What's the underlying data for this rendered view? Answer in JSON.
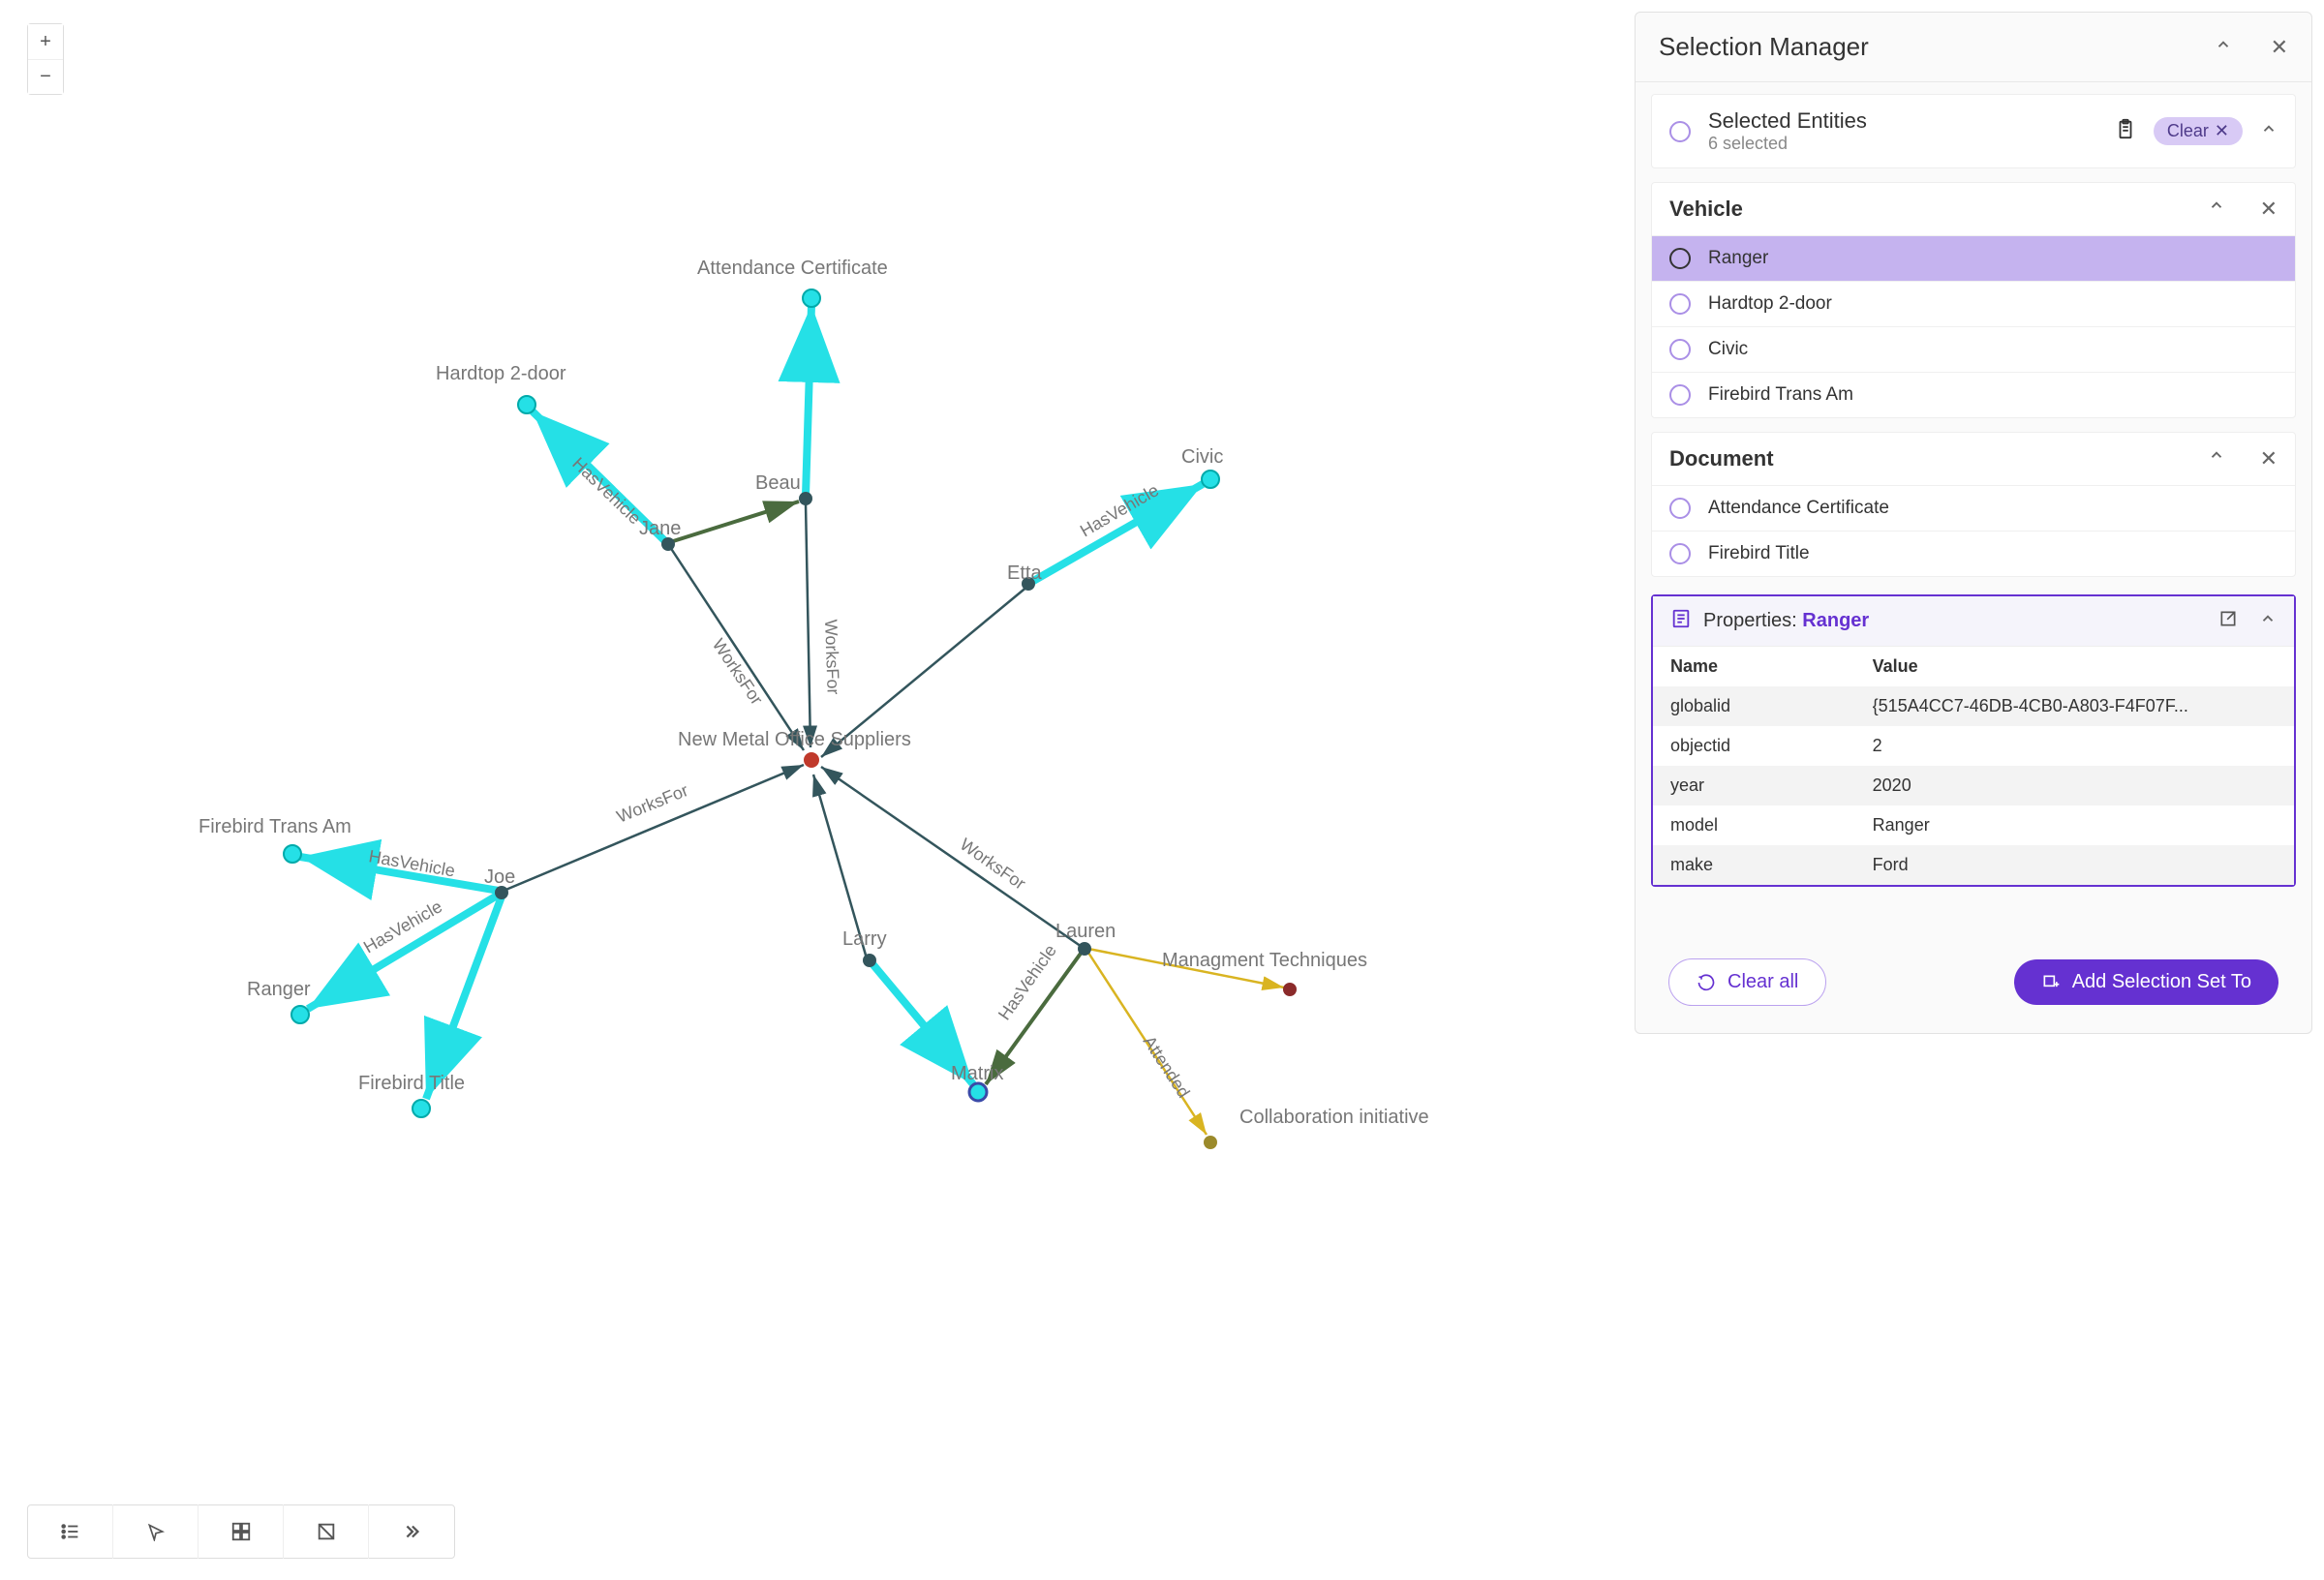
{
  "zoom": {
    "in": "+",
    "out": "−"
  },
  "toolbar": {
    "tool1": "list-icon",
    "tool2": "cursor-icon",
    "tool3": "select-group-icon",
    "tool4": "geometry-icon",
    "tool5": "more-icon"
  },
  "graph": {
    "nodes": {
      "attendance_cert": "Attendance Certificate",
      "hardtop": "Hardtop 2-door",
      "beau": "Beau",
      "jane": "Jane",
      "civic": "Civic",
      "etta": "Etta",
      "new_metal": "New Metal Office Suppliers",
      "firebird_trans_am": "Firebird Trans Am",
      "joe": "Joe",
      "ranger": "Ranger",
      "firebird_title": "Firebird Title",
      "larry": "Larry",
      "lauren": "Lauren",
      "matrix": "Matrix",
      "mgmt_tech": "Managment Techniques",
      "collab": "Collaboration initiative"
    },
    "edges": {
      "has_vehicle": "HasVehicle",
      "works_for": "WorksFor",
      "attended": "Attended"
    }
  },
  "panel": {
    "title": "Selection Manager",
    "selected_entities_label": "Selected Entities",
    "selected_count": "6 selected",
    "clear_label": "Clear",
    "sections": {
      "vehicle": {
        "title": "Vehicle",
        "items": [
          "Ranger",
          "Hardtop 2-door",
          "Civic",
          "Firebird Trans Am"
        ]
      },
      "document": {
        "title": "Document",
        "items": [
          "Attendance Certificate",
          "Firebird Title"
        ]
      }
    },
    "properties": {
      "header_label": "Properties:",
      "entity": "Ranger",
      "columns": {
        "name": "Name",
        "value": "Value"
      },
      "rows": [
        {
          "name": "globalid",
          "value": "{515A4CC7-46DB-4CB0-A803-F4F07F..."
        },
        {
          "name": "objectid",
          "value": "2"
        },
        {
          "name": "year",
          "value": "2020"
        },
        {
          "name": "model",
          "value": "Ranger"
        },
        {
          "name": "make",
          "value": "Ford"
        }
      ]
    },
    "footer": {
      "clear_all": "Clear all",
      "add_to": "Add Selection Set To"
    }
  }
}
